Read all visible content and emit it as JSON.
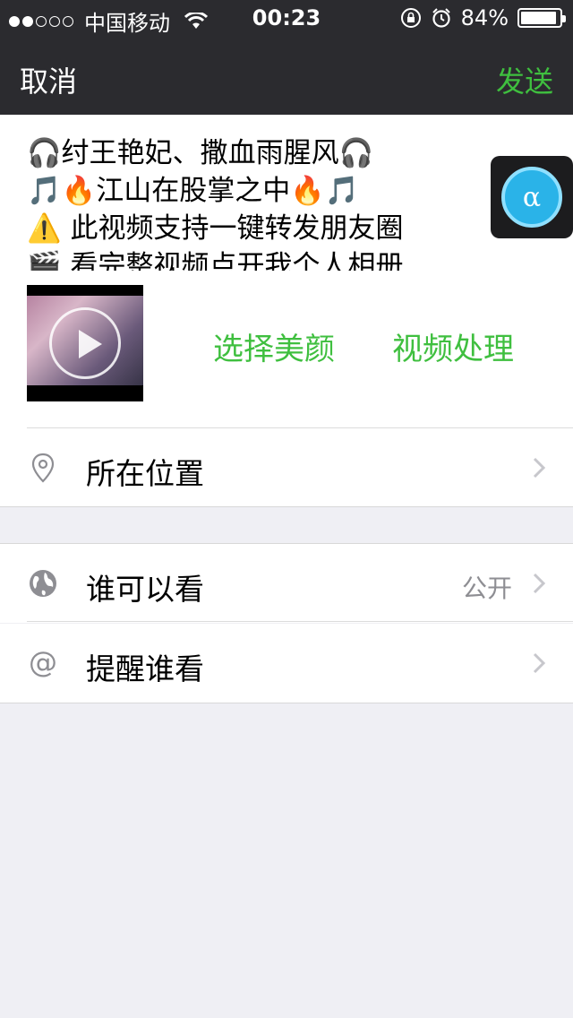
{
  "status_bar": {
    "carrier": "中国移动",
    "time": "00:23",
    "battery_percent": "84%",
    "battery_level": 0.84,
    "signal_dots_filled": 2,
    "icons": [
      "wifi-icon",
      "rotation-lock-icon",
      "alarm-icon",
      "battery-icon"
    ]
  },
  "nav": {
    "cancel_label": "取消",
    "send_label": "发送"
  },
  "compose": {
    "post_text": "🎧纣王艳妃、撒血雨腥风🎧\n🎵🔥江山在股掌之中🔥🎵\n⚠️ 此视频支持一键转发朋友圈\n🎬 看完整视频点开我个人相册",
    "floating_app_glyph": "α",
    "video_thumbnail": "video-thumbnail",
    "beauty_label": "选择美颜",
    "process_label": "视频处理"
  },
  "location_row": {
    "label": "所在位置",
    "icon": "location-pin-icon"
  },
  "visibility_row": {
    "label": "谁可以看",
    "value": "公开",
    "icon": "globe-icon"
  },
  "mention_row": {
    "label": "提醒谁看",
    "icon": "at-icon"
  },
  "colors": {
    "accent_green": "#3fbf3f",
    "nav_bg": "#2b2b2f",
    "page_bg": "#efeff4"
  }
}
